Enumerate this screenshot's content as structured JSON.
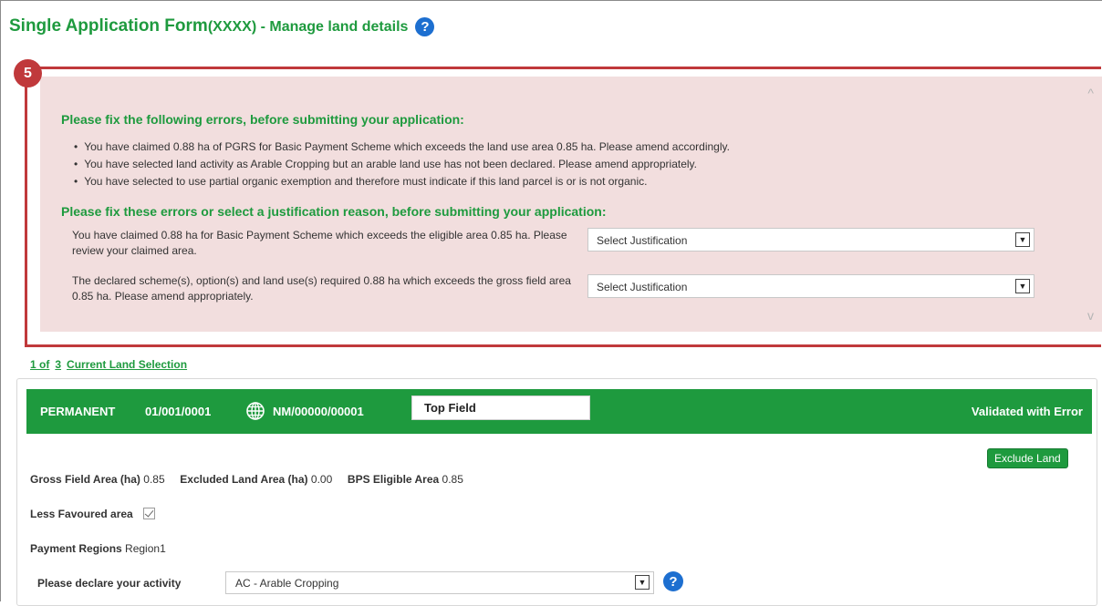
{
  "page": {
    "title": "Single Application Form",
    "title_suffix": "(XXXX) - Manage land details",
    "help_icon": "?"
  },
  "step": {
    "number": "5"
  },
  "errors": {
    "heading": "Please fix the following errors, before submitting your application:",
    "items": [
      "You have claimed 0.88 ha of PGRS for Basic Payment Scheme which exceeds the land use area 0.85 ha. Please amend accordingly.",
      "You have selected land activity as Arable Cropping but an arable land use has not been declared. Please amend appropriately.",
      "You have selected to use partial organic exemption and therefore must indicate if this land parcel is or is not organic."
    ],
    "justification_heading": "Please fix these errors or select a justification reason, before submitting your application:",
    "justifications": [
      {
        "text": "You have claimed 0.88 ha for Basic Payment Scheme which exceeds the eligible area 0.85 ha. Please review your claimed area.",
        "select_value": "Select Justification"
      },
      {
        "text": "The declared scheme(s), option(s) and land use(s) required 0.88 ha which exceeds the gross field area 0.85 ha. Please amend appropriately.",
        "select_value": "Select Justification"
      }
    ],
    "scroll_up": "^",
    "scroll_down": "v"
  },
  "selection": {
    "current": "1 of",
    "total": "3",
    "label": "Current Land Selection"
  },
  "land": {
    "status_type": "PERMANENT",
    "parcel_ref": "01/001/0001",
    "globe_icon": "globe-icon",
    "map_ref": "NM/00000/00001",
    "field_name": "Top Field",
    "validation_status": "Validated with Error",
    "exclude_label": "Exclude Land",
    "gross_label": "Gross Field Area (ha)",
    "gross_value": "0.85",
    "excluded_label": "Excluded Land Area (ha)",
    "excluded_value": "0.00",
    "bps_label": "BPS Eligible Area",
    "bps_value": "0.85",
    "lfa_label": "Less Favoured area",
    "lfa_checked": true,
    "regions_label": "Payment Regions",
    "regions_value": "Region1",
    "activity_label": "Please declare your activity",
    "activity_value": "AC - Arable Cropping"
  },
  "colors": {
    "brand_green": "#1e9a3e",
    "error_bg": "#f2dede",
    "error_border": "#c0393b",
    "help_blue": "#1d6fd0"
  }
}
